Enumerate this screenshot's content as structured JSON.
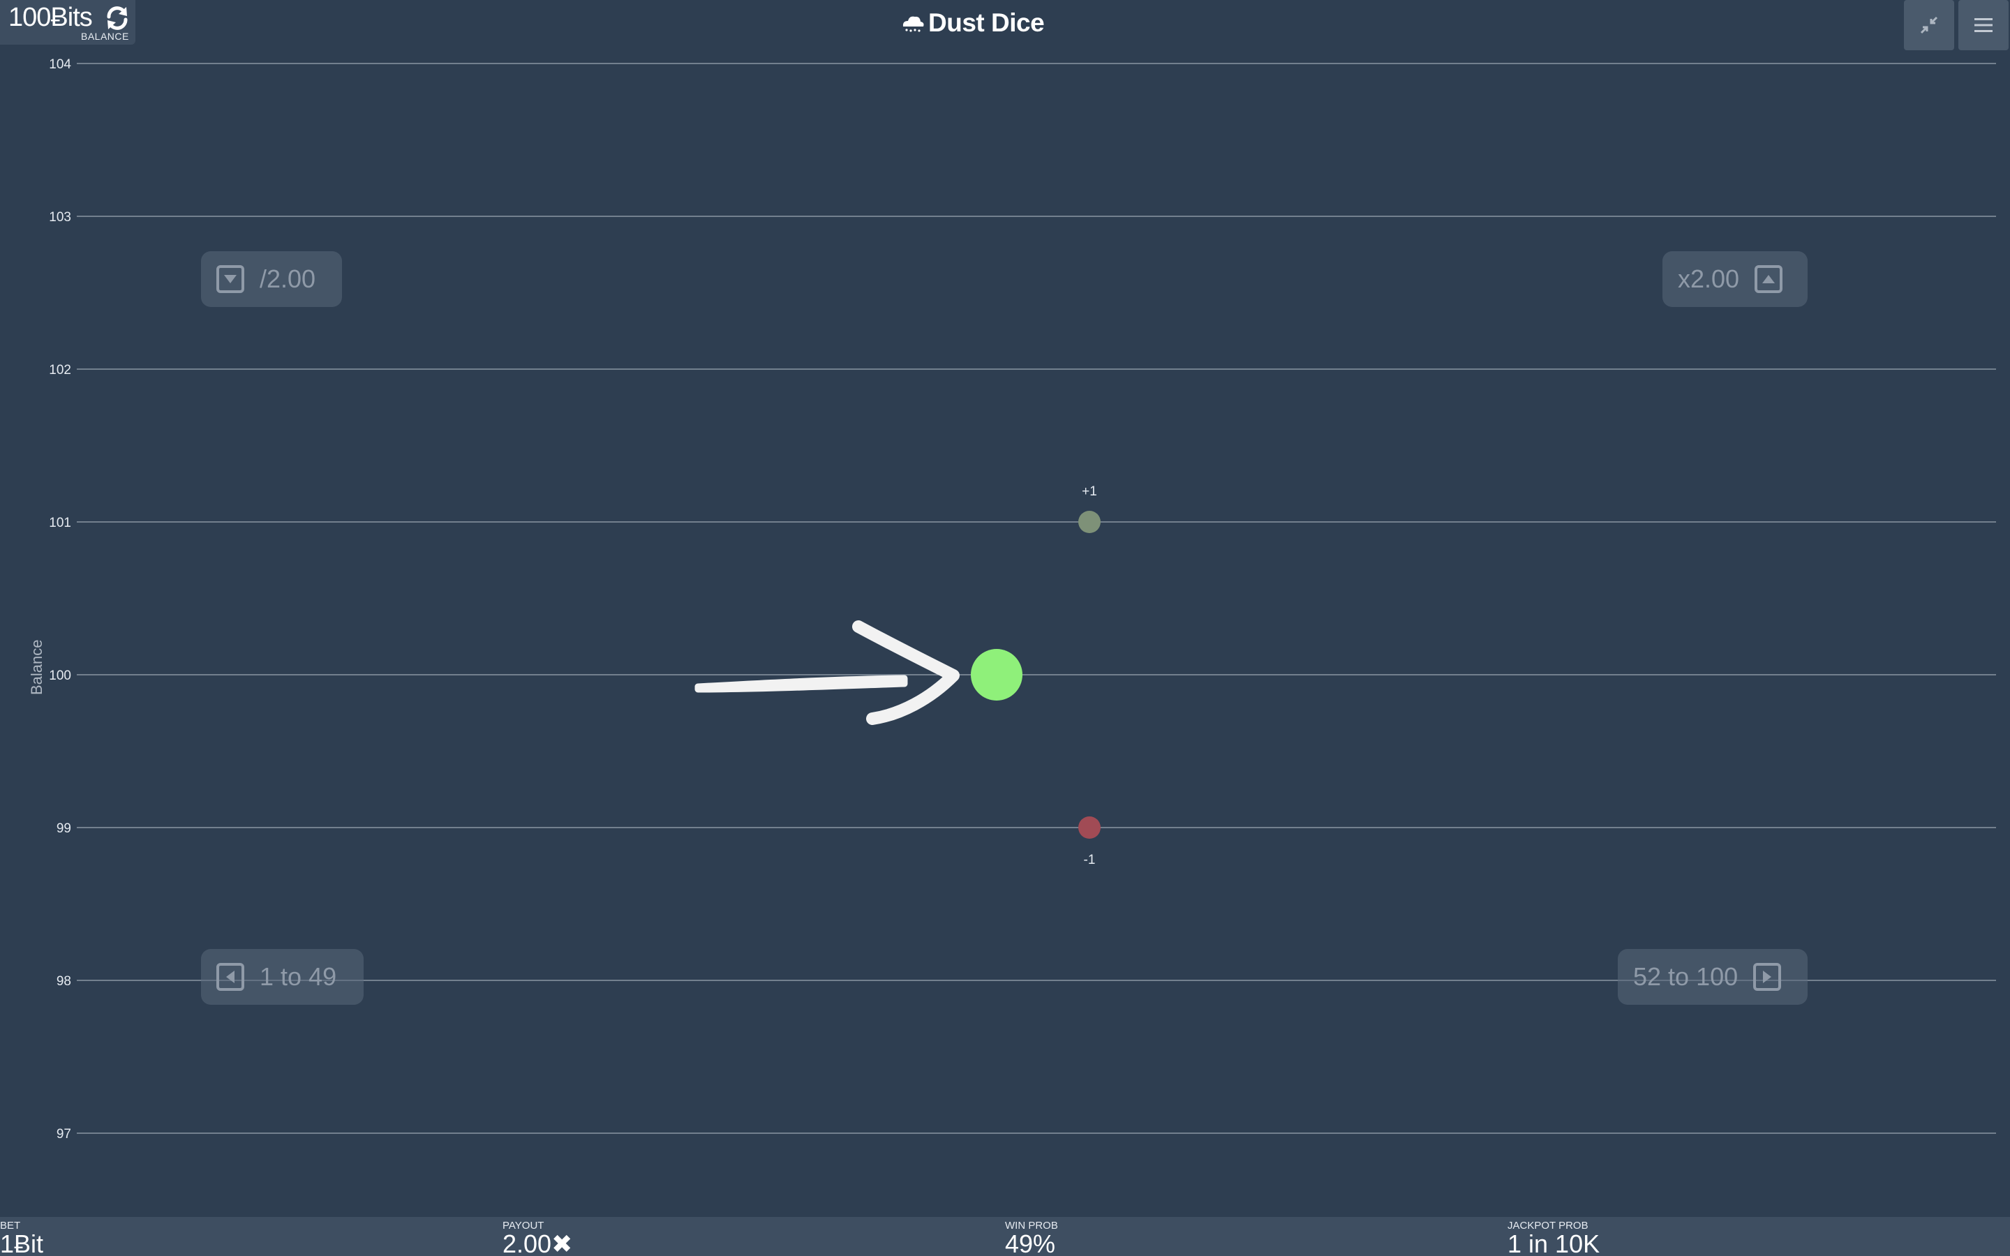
{
  "header": {
    "balance_value": "100Ƀits",
    "balance_caption": "BALANCE",
    "title": "Dust Dice"
  },
  "chart_data": {
    "type": "scatter",
    "ylabel": "Balance",
    "ylim": [
      96.5,
      104
    ],
    "y_ticks": [
      104,
      103,
      102,
      101,
      100,
      99,
      98,
      97
    ],
    "grid": true,
    "points": [
      {
        "y": 100,
        "role": "current",
        "color": "#8ff07a"
      },
      {
        "y": 101,
        "role": "win-outcome",
        "label": "+1",
        "color": "#7e9178"
      },
      {
        "y": 99,
        "role": "loss-outcome",
        "label": "-1",
        "color": "#a14b55"
      }
    ]
  },
  "controls": {
    "halve_label": "/2.00",
    "double_label": "x2.00",
    "low_range_label": "1 to 49",
    "high_range_label": "52 to 100"
  },
  "stats": {
    "bet_caption": "BET",
    "bet_value": "1Ƀit",
    "payout_caption": "PAYOUT",
    "payout_value": "2.00✖",
    "winprob_caption": "WIN PROB",
    "winprob_value": "49%",
    "jackpot_caption": "JACKPOT PROB",
    "jackpot_value": "1 in 10K"
  },
  "icons": {
    "refresh": "refresh-icon",
    "cloud": "cloud-icon",
    "compress": "compress-icon",
    "menu": "menu-icon"
  }
}
